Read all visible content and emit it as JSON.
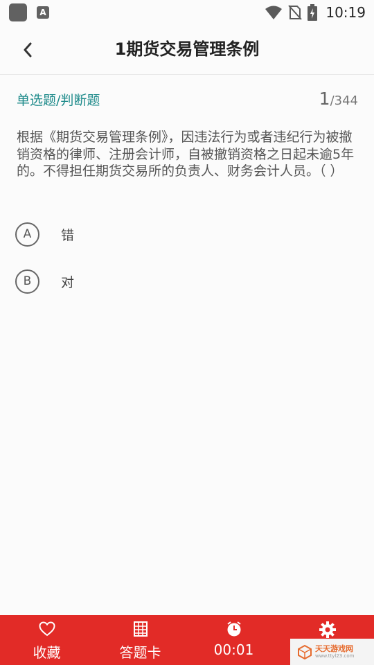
{
  "status_bar": {
    "time": "10:19",
    "app_badge": "A"
  },
  "header": {
    "title": "1期货交易管理条例"
  },
  "question": {
    "type": "单选题/判断题",
    "current": "1",
    "total": "/344",
    "text": "根据《期货交易管理条例》，因违法行为或者违纪行为被撤销资格的律师、注册会计师，自被撤销资格之日起未逾5年的。不得担任期货交易所的负责人、财务会计人员。（ ）",
    "options": [
      {
        "letter": "A",
        "label": "错"
      },
      {
        "letter": "B",
        "label": "对"
      }
    ]
  },
  "bottom_bar": {
    "background": "#e22b27",
    "favorite_label": "收藏",
    "answer_card_label": "答题卡",
    "timer": "00:01"
  },
  "watermark": {
    "name": "天天游戏网",
    "url": "www.ttyl23.com"
  },
  "colors": {
    "accent_teal": "#1d8a8a",
    "bar_red": "#e22b27"
  }
}
